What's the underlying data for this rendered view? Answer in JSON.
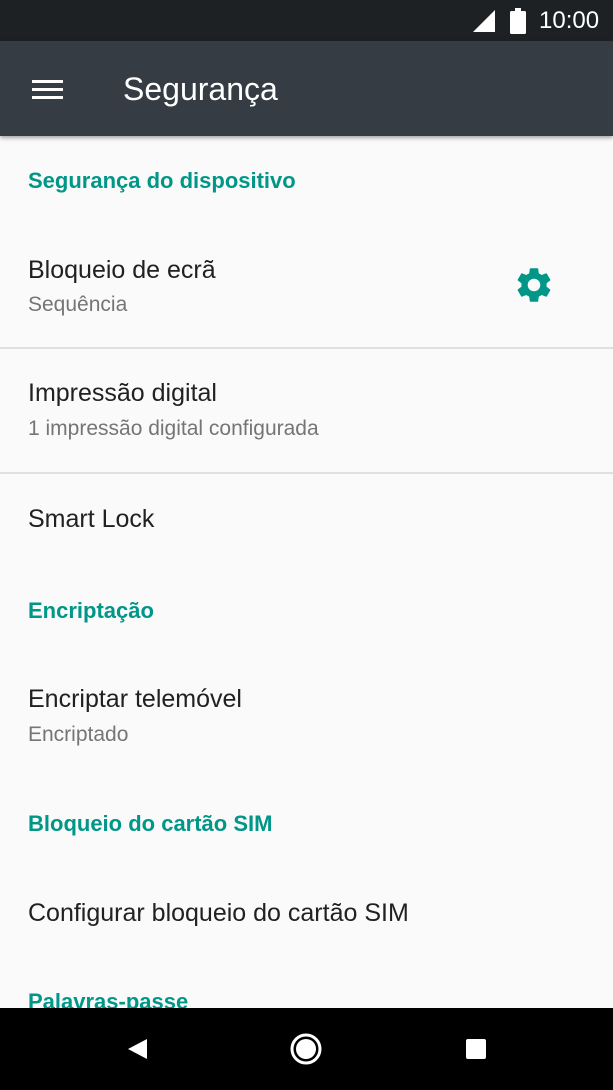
{
  "status_bar": {
    "time": "10:00",
    "icons": [
      "signal-icon",
      "battery-icon"
    ]
  },
  "app_bar": {
    "title": "Segurança",
    "menu_icon": "menu-icon"
  },
  "colors": {
    "accent": "#009688",
    "app_bar": "#353c43",
    "status_bar": "#1d2124",
    "background": "#fafafa"
  },
  "sections": [
    {
      "header": "Segurança do dispositivo",
      "items": [
        {
          "title": "Bloqueio de ecrã",
          "summary": "Sequência",
          "icon": "gear-icon"
        },
        {
          "title": "Impressão digital",
          "summary": "1 impressão digital configurada"
        },
        {
          "title": "Smart Lock"
        }
      ]
    },
    {
      "header": "Encriptação",
      "items": [
        {
          "title": "Encriptar telemóvel",
          "summary": "Encriptado"
        }
      ]
    },
    {
      "header": "Bloqueio do cartão SIM",
      "items": [
        {
          "title": "Configurar bloqueio do cartão SIM"
        }
      ]
    },
    {
      "header": "Palavras-passe",
      "items": []
    }
  ],
  "nav_bar": {
    "buttons": [
      "back-icon",
      "home-icon",
      "recents-icon"
    ]
  }
}
